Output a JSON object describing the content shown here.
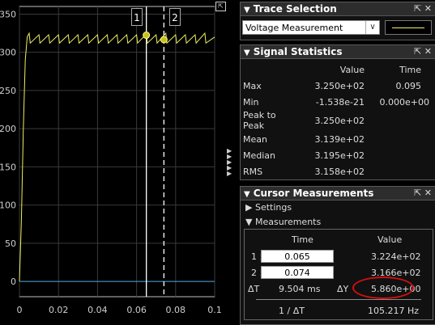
{
  "scope": {
    "y_ticks": [
      "350",
      "300",
      "250",
      "200",
      "150",
      "100",
      "50",
      "0"
    ],
    "x_ticks": [
      "0",
      "0.02",
      "0.04",
      "0.06",
      "0.08",
      "0.1"
    ],
    "cursor1_label": "1",
    "cursor2_label": "2",
    "trace_color": "#f0f060",
    "baseline_color": "#4aa0e0"
  },
  "chart_data": {
    "type": "line",
    "xlim": [
      0,
      0.1
    ],
    "ylim": [
      -20,
      360
    ],
    "series": [
      {
        "x": [
          0,
          0.001,
          0.002,
          0.003,
          0.004,
          0.005,
          0.0055,
          0.01,
          0.0105,
          0.015,
          0.0155,
          0.02,
          0.0205,
          0.025,
          0.0255,
          0.03,
          0.0305,
          0.035,
          0.0355,
          0.04,
          0.0405,
          0.045,
          0.0455,
          0.05,
          0.0505,
          0.055,
          0.0555,
          0.06,
          0.0605,
          0.065,
          0.0655,
          0.07,
          0.0705,
          0.075,
          0.0755,
          0.08,
          0.0805,
          0.085,
          0.0855,
          0.09,
          0.0905,
          0.095,
          0.0955,
          0.1
        ],
        "values": [
          0,
          80,
          200,
          290,
          320,
          325,
          312,
          323,
          312,
          323,
          312,
          323,
          312,
          323,
          312,
          323,
          312,
          323,
          312,
          323,
          312,
          323,
          312,
          323,
          312,
          323,
          312,
          323,
          312,
          324,
          312,
          323,
          312,
          325,
          312,
          323,
          312,
          323,
          312,
          323,
          312,
          325,
          312,
          320
        ]
      },
      {
        "x": [
          0,
          0.1
        ],
        "values": [
          0,
          0
        ]
      }
    ],
    "cursors": [
      {
        "label": "1",
        "x": 0.065,
        "y": 322.4
      },
      {
        "label": "2",
        "x": 0.074,
        "y": 316.6
      }
    ]
  },
  "trace_selection": {
    "title": "Trace Selection",
    "selected": "Voltage Measurement"
  },
  "signal_statistics": {
    "title": "Signal Statistics",
    "col_value": "Value",
    "col_time": "Time",
    "rows": [
      {
        "label": "Max",
        "value": "3.250e+02",
        "time": "0.095"
      },
      {
        "label": "Min",
        "value": "-1.538e-21",
        "time": "0.000e+00"
      },
      {
        "label": "Peak to Peak",
        "value": "3.250e+02",
        "time": ""
      },
      {
        "label": "Mean",
        "value": "3.139e+02",
        "time": ""
      },
      {
        "label": "Median",
        "value": "3.195e+02",
        "time": ""
      },
      {
        "label": "RMS",
        "value": "3.158e+02",
        "time": ""
      }
    ]
  },
  "cursor_measurements": {
    "title": "Cursor Measurements",
    "settings_label": "Settings",
    "measurements_label": "Measurements",
    "col_time": "Time",
    "col_value": "Value",
    "c1_label": "1",
    "c1_time": "0.065",
    "c1_value": "3.224e+02",
    "c2_label": "2",
    "c2_time": "0.074",
    "c2_value": "3.166e+02",
    "dt_label": "ΔT",
    "dt_value": "9.504 ms",
    "dy_label": "ΔY",
    "dy_value": "5.860e+00",
    "inv_label": "1 / ΔT",
    "inv_value": "105.217 Hz"
  }
}
